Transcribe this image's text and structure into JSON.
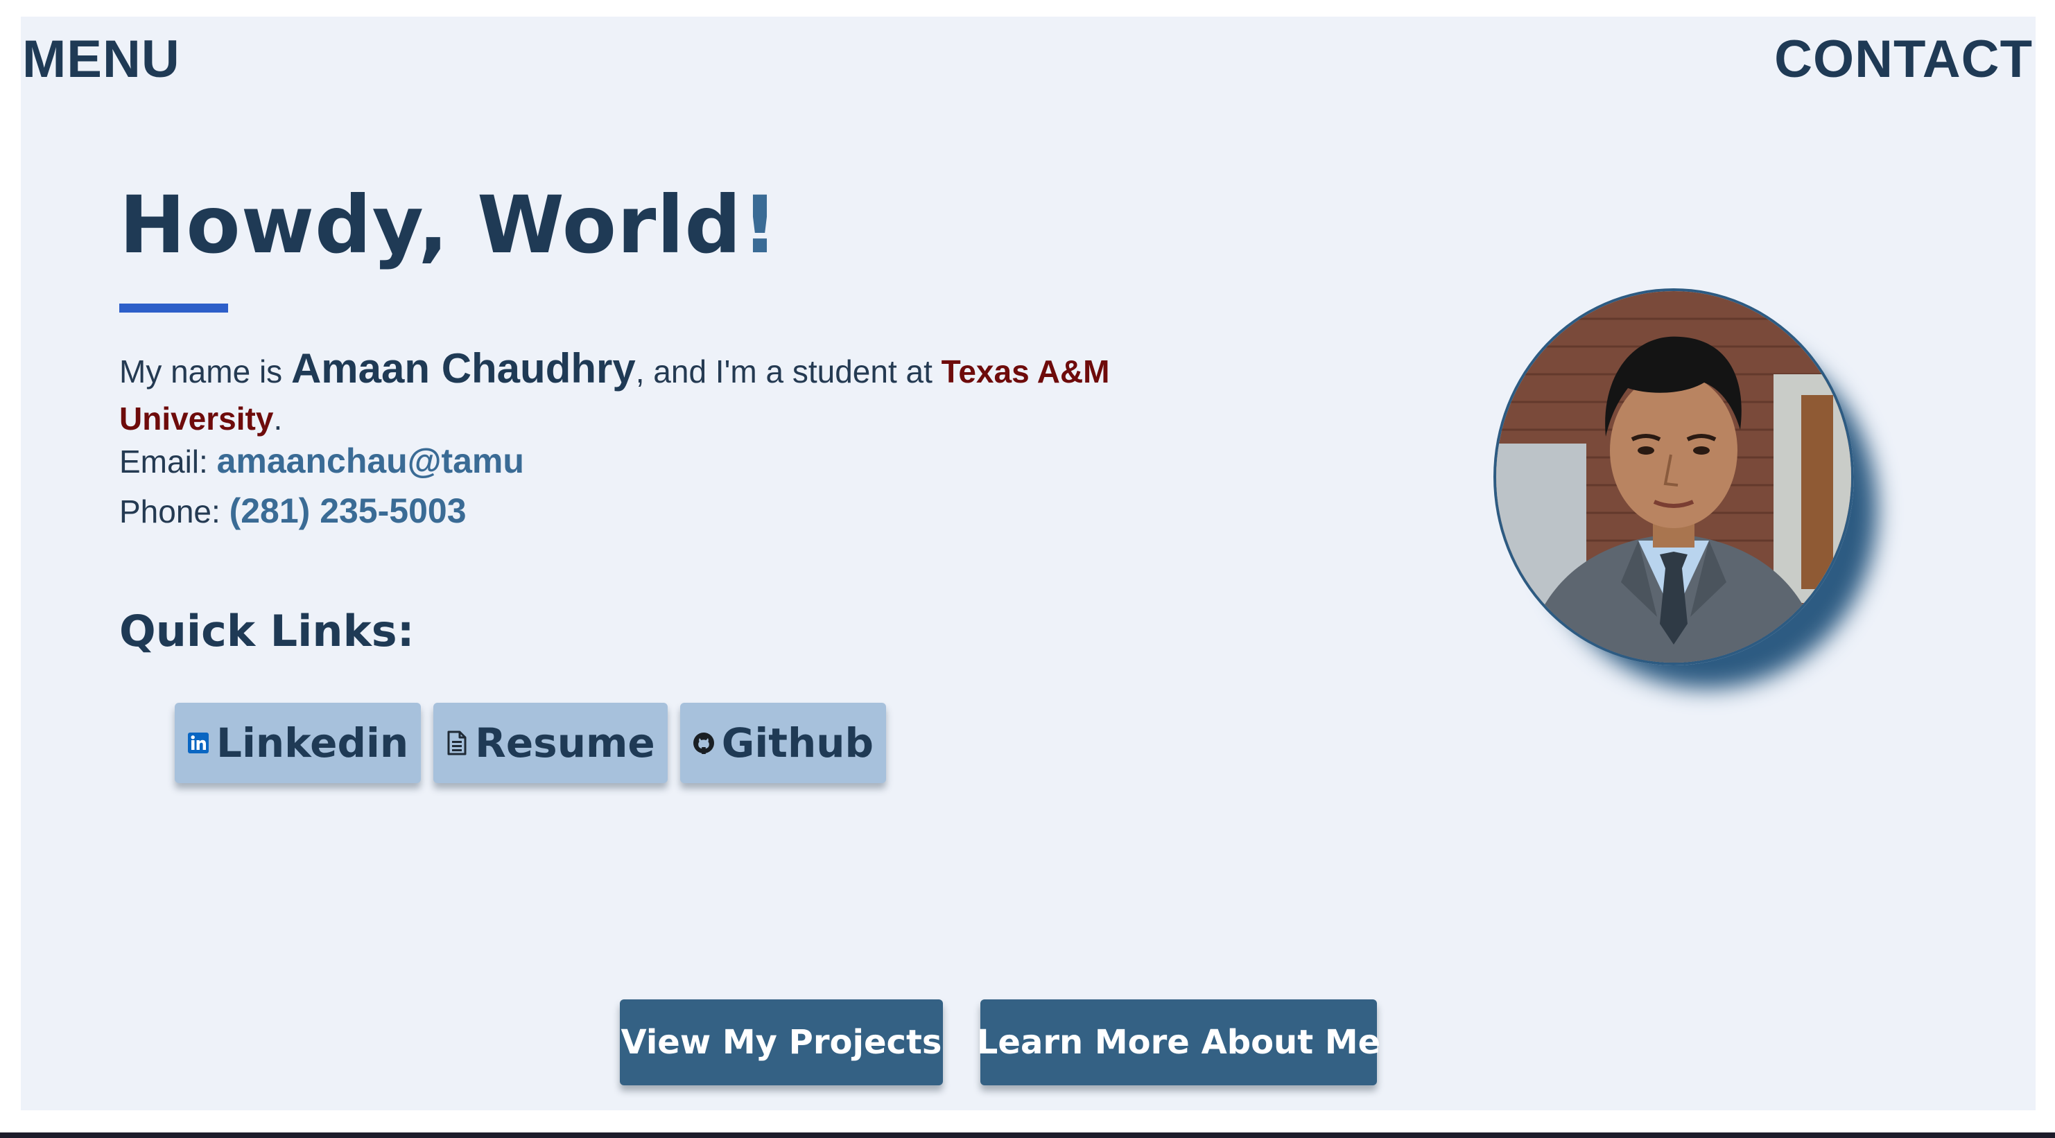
{
  "nav": {
    "menu_label": "MENU",
    "contact_label": "CONTACT"
  },
  "hero": {
    "title": "Howdy, World",
    "title_bang": "!",
    "intro_prefix": "My name is ",
    "name": "Amaan Chaudhry",
    "intro_middle": ", and I'm a student at ",
    "school": "Texas A&M University",
    "intro_suffix": ".",
    "email_label": "Email: ",
    "email_value": "amaanchau@tamu",
    "phone_label": "Phone: ",
    "phone_value": "(281) 235-5003"
  },
  "quick_links": {
    "title": "Quick Links:",
    "items": [
      {
        "label": "Linkedin",
        "icon": "linkedin-icon"
      },
      {
        "label": "Resume",
        "icon": "document-icon"
      },
      {
        "label": "Github",
        "icon": "github-icon"
      }
    ]
  },
  "actions": {
    "projects_label": "View My Projects",
    "about_label": "Learn More About Me"
  },
  "colors": {
    "background": "#eef2f9",
    "text_primary": "#1f3a55",
    "accent_blue": "#3a6b95",
    "underline": "#2d5fc9",
    "school_maroon": "#6e0b0b",
    "quick_link_bg": "#a7c1dc",
    "cta_bg": "#346184"
  }
}
